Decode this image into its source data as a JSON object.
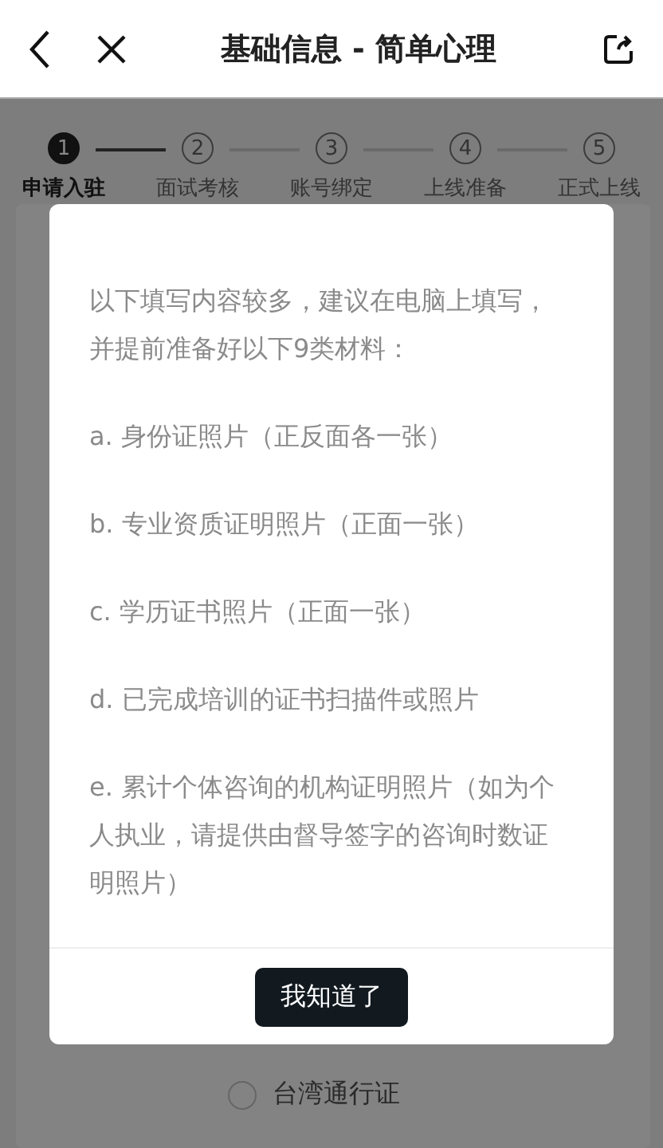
{
  "header": {
    "title": "基础信息 - 简单心理"
  },
  "steps": [
    {
      "number": "1",
      "label": "申请入驻",
      "selected": true
    },
    {
      "number": "2",
      "label": "面试考核",
      "selected": false
    },
    {
      "number": "3",
      "label": "账号绑定",
      "selected": false
    },
    {
      "number": "4",
      "label": "上线准备",
      "selected": false
    },
    {
      "number": "5",
      "label": "正式上线",
      "selected": false
    }
  ],
  "form": {
    "options": [
      {
        "label": "台湾通行证",
        "checked": false
      }
    ]
  },
  "dialog": {
    "paragraphs": [
      "以下填写内容较多，建议在电脑上填写，并提前准备好以下9类材料：",
      "a. 身份证照片（正反面各一张）",
      "b. 专业资质证明照片（正面一张）",
      "c. 学历证书照片（正面一张）",
      "d. 已完成培训的证书扫描件或照片",
      "e. 累计个体咨询的机构证明照片（如为个人执业，请提供由督导签字的咨询时数证明照片）"
    ],
    "button": "我知道了"
  }
}
